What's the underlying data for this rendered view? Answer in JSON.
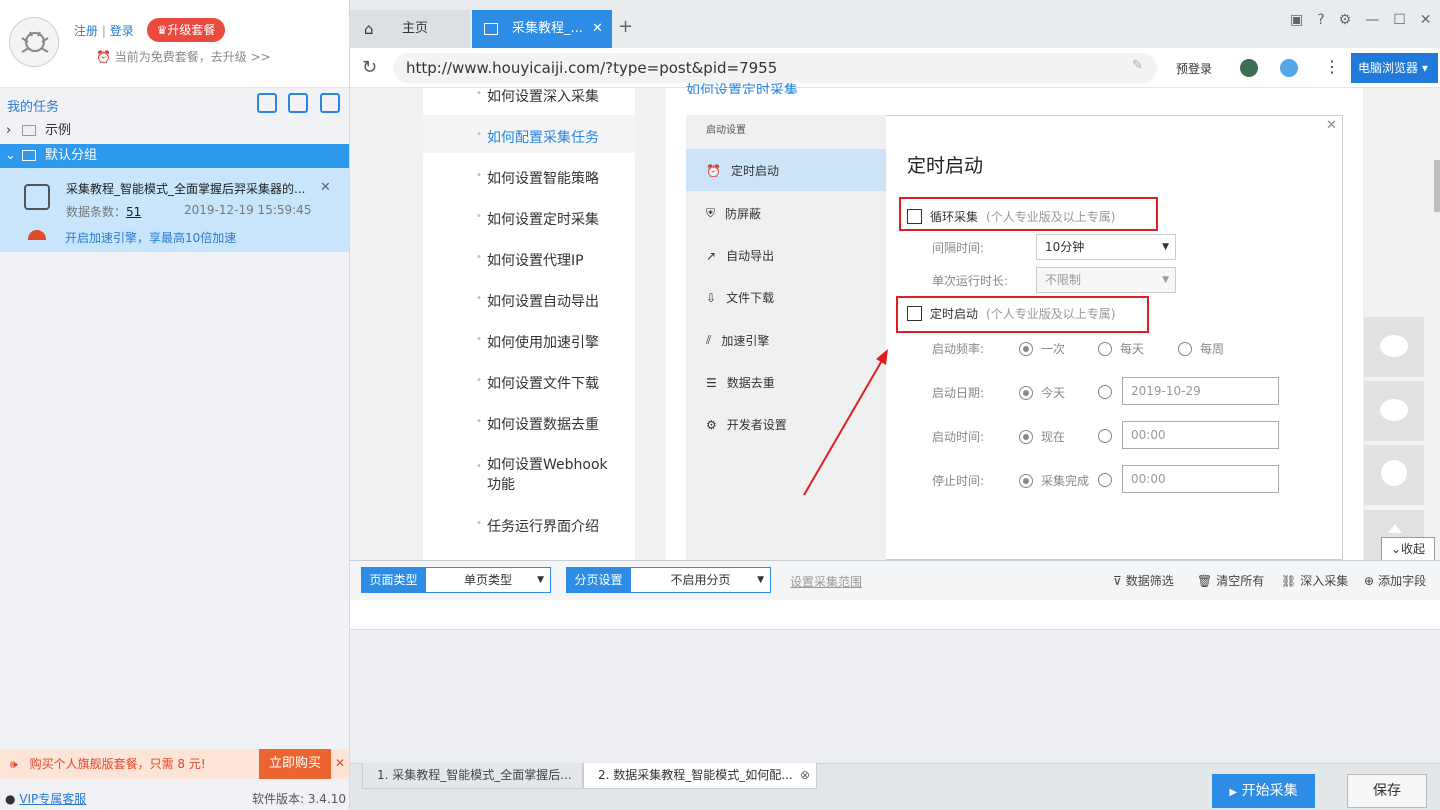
{
  "account": {
    "register": "注册",
    "separator": "|",
    "login": "登录",
    "upgrade": "升级套餐",
    "plan_hint": "当前为免费套餐，去升级 >>"
  },
  "sidebar": {
    "my_tasks": "我的任务",
    "groups": [
      {
        "label": "示例"
      },
      {
        "label": "默认分组"
      }
    ],
    "task": {
      "title": "采集教程_智能模式_全面掌握后羿采集器的...",
      "count_label": "数据条数：",
      "count": "51",
      "time": "2019-12-19 15:59:45",
      "speedup": "开启加速引擎，享最高10倍加速"
    },
    "promo": {
      "text": "购买个人旗舰版套餐，只需 8 元!",
      "buy": "立即购买"
    },
    "vip": "VIP专属客服",
    "version": "软件版本: 3.4.10"
  },
  "browser": {
    "tabs": [
      {
        "label": "主页"
      },
      {
        "label": "采集教程_..."
      }
    ],
    "url": "http://www.houyicaiji.com/?type=post&pid=7955",
    "prelogin": "预登录",
    "pc_browser": "电脑浏览器"
  },
  "webpage": {
    "heading_partial": "如何设置定时采集",
    "menu": [
      "如何设置深入采集",
      "如何配置采集任务",
      "如何设置智能策略",
      "如何设置定时采集",
      "如何设置代理IP",
      "如何设置自动导出",
      "如何使用加速引擎",
      "如何设置文件下载",
      "如何设置数据去重",
      "如何设置Webhook功能",
      "任务运行界面介绍"
    ],
    "dialog": {
      "title": "启动设置",
      "nav": [
        "定时启动",
        "防屏蔽",
        "自动导出",
        "文件下载",
        "加速引擎",
        "数据去重",
        "开发者设置"
      ],
      "heading": "定时启动",
      "loop": {
        "label": "循环采集",
        "note": "(个人专业版及以上专属)"
      },
      "interval": {
        "label": "间隔时间:",
        "value": "10分钟"
      },
      "single_run": {
        "label": "单次运行时长:",
        "value": "不限制"
      },
      "timed": {
        "label": "定时启动",
        "note": "(个人专业版及以上专属)"
      },
      "freq": {
        "label": "启动频率:",
        "options": [
          "一次",
          "每天",
          "每周"
        ]
      },
      "date": {
        "label": "启动日期:",
        "option": "今天",
        "value": "2019-10-29"
      },
      "time": {
        "label": "启动时间:",
        "option": "现在",
        "value": "00:00"
      },
      "stop": {
        "label": "停止时间:",
        "option": "采集完成",
        "value": "00:00"
      }
    },
    "collapse": "收起"
  },
  "toolbar": {
    "page_type_label": "页面类型",
    "page_type_value": "单页类型",
    "paging_label": "分页设置",
    "paging_value": "不启用分页",
    "range": "设置采集范围",
    "actions": [
      "数据筛选",
      "清空所有",
      "深入采集",
      "添加字段"
    ]
  },
  "bottom_tabs": [
    "1. 采集教程_智能模式_全面掌握后...",
    "2. 数据采集教程_智能模式_如何配..."
  ],
  "buttons": {
    "start": "开始采集",
    "save": "保存"
  }
}
